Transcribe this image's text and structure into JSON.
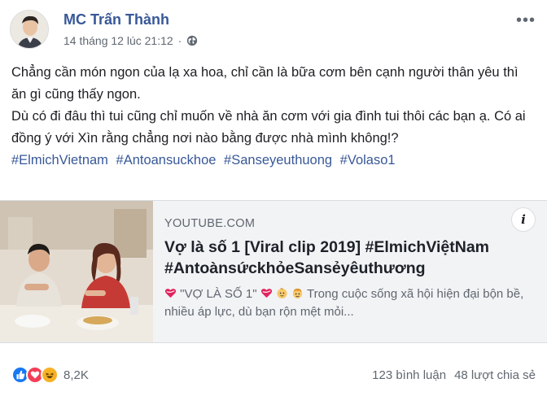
{
  "post": {
    "author": "MC Trấn Thành",
    "timestamp": "14 tháng 12 lúc 21:12",
    "separator": "·",
    "privacy_icon": "globe-icon",
    "more_label": "•••",
    "text_lines": [
      "Chẳng cần món ngon của lạ xa hoa, chỉ cần là bữa cơm bên cạnh người thân yêu thì ăn gì cũng thấy ngon.",
      "Dù có đi đâu thì tui cũng chỉ muốn về nhà ăn cơm với gia đình tui thôi các bạn ạ. Có ai đồng ý với Xìn rằng chẳng nơi nào bằng được nhà mình không!?"
    ],
    "hashtags": [
      "#ElmichVietnam",
      "#Antoansuckhoe",
      "#Sanseyeuthuong",
      "#Volaso1"
    ]
  },
  "link_card": {
    "domain": "YOUTUBE.COM",
    "title": "Vợ là số 1 [Viral clip 2019] #ElmichViệtNam #AntoànsứckhỏeSansẻyêuthương",
    "desc_quote": "\"VỢ LÀ SỐ 1\"",
    "desc_rest": "Trong cuộc sống xã hội hiện đại bộn bề, nhiều áp lực, dù bạn rộn mệt mỏi...",
    "info_label": "i",
    "icons": [
      "heart-ribbon-emoji",
      "baby-emoji",
      "child-emoji"
    ]
  },
  "footer": {
    "reaction_icons": [
      "like-icon",
      "love-icon",
      "haha-icon"
    ],
    "reaction_count": "8,2K",
    "comments": "123 bình luận",
    "shares": "48 lượt chia sẻ"
  },
  "colors": {
    "link_blue": "#385898",
    "meta_gray": "#606770",
    "card_bg": "#f2f3f5",
    "like_blue": "#1877f2",
    "love_red": "#f33e58",
    "haha_yellow": "#f7b125"
  }
}
